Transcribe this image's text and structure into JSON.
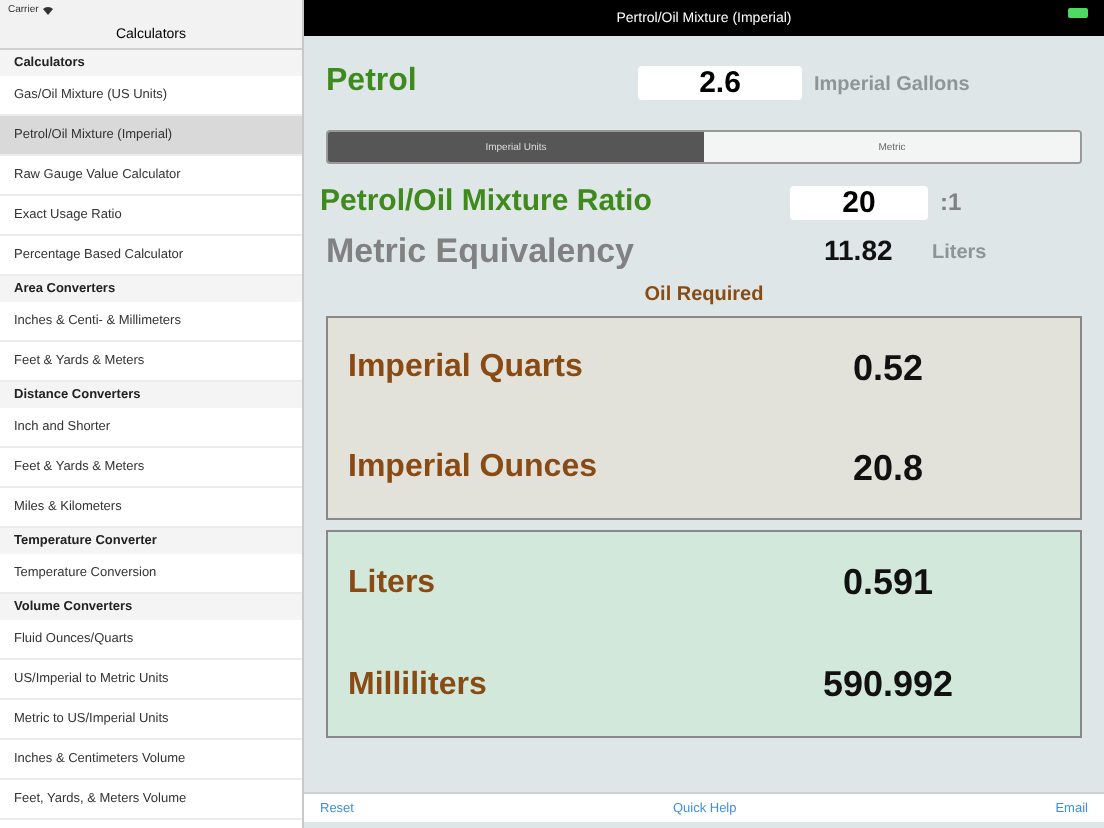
{
  "status_bar": {
    "carrier": "Carrier"
  },
  "sidebar": {
    "title": "Calculators",
    "sections": [
      {
        "header": "Calculators",
        "items": [
          {
            "label": "Gas/Oil Mixture (US Units)",
            "selected": false
          },
          {
            "label": "Petrol/Oil Mixture (Imperial)",
            "selected": true
          },
          {
            "label": "Raw Gauge Value Calculator",
            "selected": false
          },
          {
            "label": "Exact Usage Ratio",
            "selected": false
          },
          {
            "label": "Percentage Based Calculator",
            "selected": false
          }
        ]
      },
      {
        "header": "Area Converters",
        "items": [
          {
            "label": "Inches & Centi- & Millimeters",
            "selected": false
          },
          {
            "label": "Feet & Yards & Meters",
            "selected": false
          }
        ]
      },
      {
        "header": "Distance Converters",
        "items": [
          {
            "label": "Inch and Shorter",
            "selected": false
          },
          {
            "label": "Feet & Yards & Meters",
            "selected": false
          },
          {
            "label": "Miles & Kilometers",
            "selected": false
          }
        ]
      },
      {
        "header": "Temperature Converter",
        "items": [
          {
            "label": "Temperature Conversion",
            "selected": false
          }
        ]
      },
      {
        "header": "Volume Converters",
        "items": [
          {
            "label": "Fluid Ounces/Quarts",
            "selected": false
          },
          {
            "label": "US/Imperial to Metric Units",
            "selected": false
          },
          {
            "label": "Metric to US/Imperial Units",
            "selected": false
          },
          {
            "label": "Inches & Centimeters Volume",
            "selected": false
          },
          {
            "label": "Feet, Yards, & Meters Volume",
            "selected": false
          }
        ]
      }
    ]
  },
  "main": {
    "title": "Pertrol/Oil Mixture (Imperial)",
    "petrol": {
      "label": "Petrol",
      "value": "2.6",
      "unit": "Imperial Gallons"
    },
    "tabs": [
      {
        "label": "Imperial Units",
        "selected": true
      },
      {
        "label": "Metric",
        "selected": false
      }
    ],
    "ratio": {
      "label": "Petrol/Oil Mixture Ratio",
      "value": "20",
      "suffix": ":1"
    },
    "metric": {
      "label": "Metric Equivalency",
      "value": "11.82",
      "unit": "Liters"
    },
    "oil_heading": "Oil Required",
    "panels": [
      {
        "kind": "imperial",
        "rows": [
          {
            "label": "Imperial Quarts",
            "value": "0.52"
          },
          {
            "label": "Imperial Ounces",
            "value": "20.8"
          }
        ]
      },
      {
        "kind": "metric",
        "rows": [
          {
            "label": "Liters",
            "value": "0.591"
          },
          {
            "label": "Milliliters",
            "value": "590.992"
          }
        ]
      }
    ]
  },
  "toolbar": {
    "buttons": [
      "Reset",
      "Quick Help",
      "Email"
    ]
  }
}
